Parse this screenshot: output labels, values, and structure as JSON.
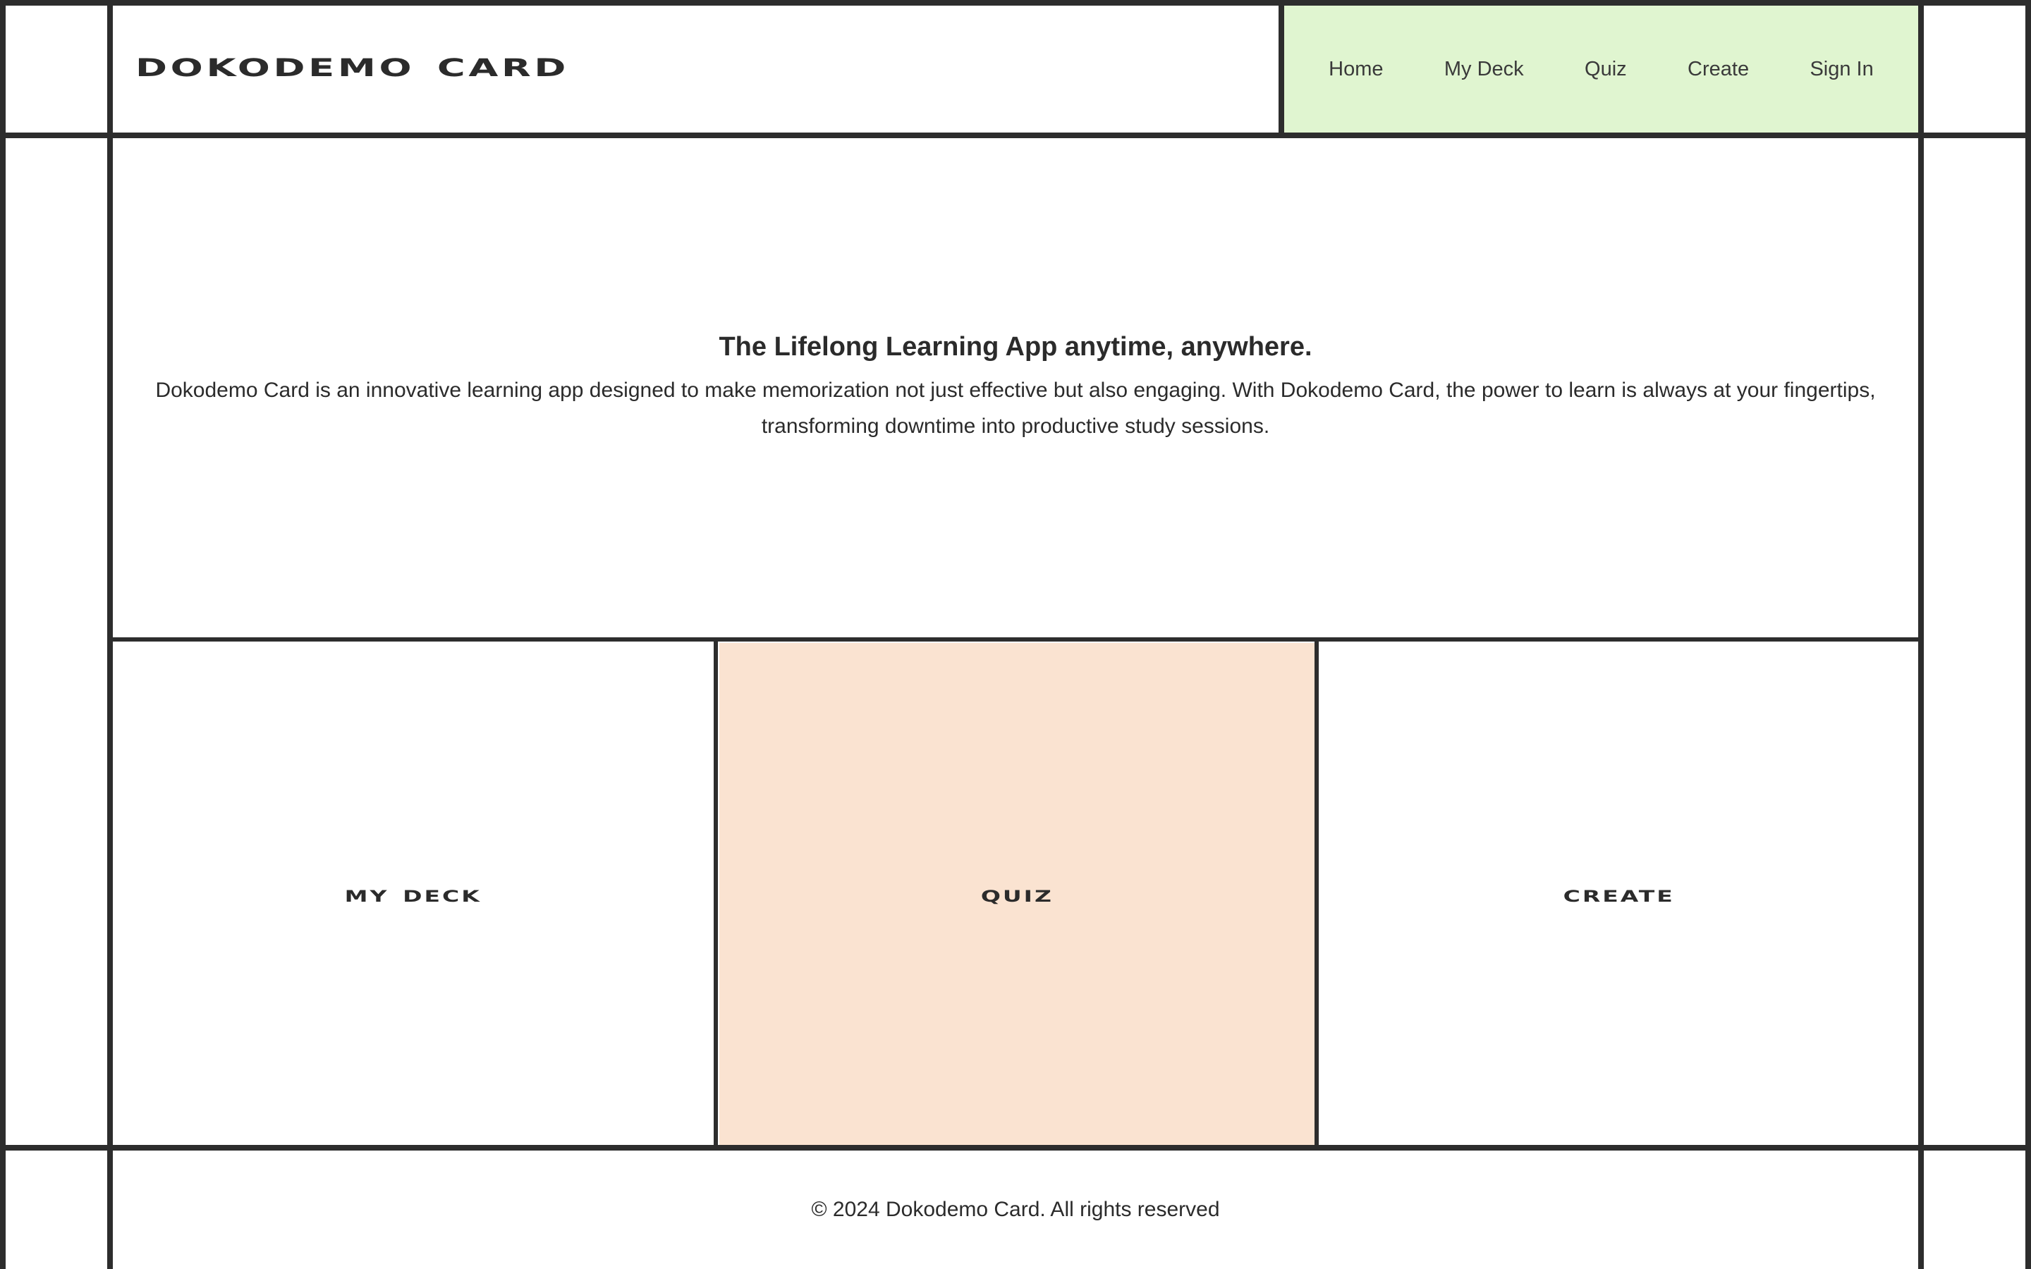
{
  "header": {
    "logo": "Dokodemo Card"
  },
  "nav": {
    "items": [
      {
        "label": "Home"
      },
      {
        "label": "My Deck"
      },
      {
        "label": "Quiz"
      },
      {
        "label": "Create"
      },
      {
        "label": "Sign In"
      }
    ]
  },
  "hero": {
    "title": "The Lifelong Learning App anytime, anywhere.",
    "text": "Dokodemo Card is an innovative learning app designed to make memorization not just effective but also engaging. With Dokodemo Card, the power to learn is always at your fingertips, transforming downtime into productive study sessions."
  },
  "cards": [
    {
      "label": "My Deck"
    },
    {
      "label": "Quiz"
    },
    {
      "label": "Create"
    }
  ],
  "footer": {
    "text": "© 2024 Dokodemo Card. All rights reserved"
  },
  "colors": {
    "border": "#2d2d2d",
    "nav_background": "#e0f5d0",
    "quiz_card_background": "#fae3d1",
    "text": "#2b2b2b"
  }
}
